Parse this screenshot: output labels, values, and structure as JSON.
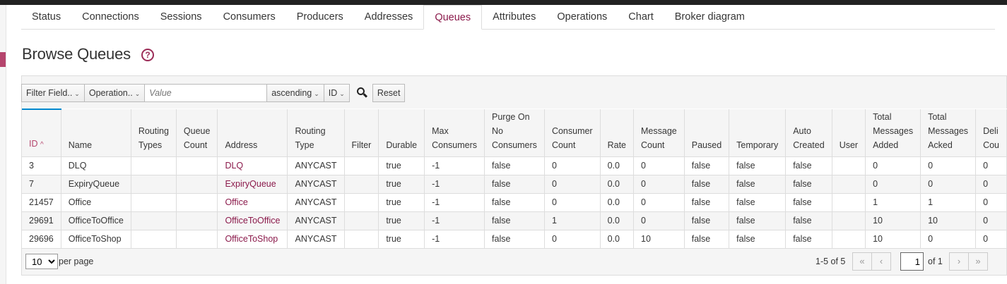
{
  "tabs": [
    {
      "label": "Status"
    },
    {
      "label": "Connections"
    },
    {
      "label": "Sessions"
    },
    {
      "label": "Consumers"
    },
    {
      "label": "Producers"
    },
    {
      "label": "Addresses"
    },
    {
      "label": "Queues",
      "active": true
    },
    {
      "label": "Attributes"
    },
    {
      "label": "Operations"
    },
    {
      "label": "Chart"
    },
    {
      "label": "Broker diagram"
    }
  ],
  "page": {
    "title": "Browse Queues",
    "help_icon": "question-circle-icon",
    "accent_color": "#8b1a4b"
  },
  "filter": {
    "field_label": "Filter Field..",
    "operation_label": "Operation..",
    "value_placeholder": "Value",
    "order_label": "ascending",
    "sort_field_label": "ID",
    "reset_label": "Reset"
  },
  "table": {
    "columns": [
      "ID",
      "Name",
      "Routing\nTypes",
      "Queue\nCount",
      "Address",
      "Routing\nType",
      "Filter",
      "Durable",
      "Max\nConsumers",
      "Purge On\nNo\nConsumers",
      "Consumer\nCount",
      "Rate",
      "Message\nCount",
      "Paused",
      "Temporary",
      "Auto\nCreated",
      "User",
      "Total\nMessages\nAdded",
      "Total\nMessages\nAcked",
      "Deli\nCou"
    ],
    "sort_indicator": "^",
    "rows": [
      [
        "3",
        "DLQ",
        "",
        "",
        "DLQ",
        "ANYCAST",
        "",
        "true",
        "-1",
        "false",
        "0",
        "0.0",
        "0",
        "false",
        "false",
        "false",
        "",
        "0",
        "0",
        "0"
      ],
      [
        "7",
        "ExpiryQueue",
        "",
        "",
        "ExpiryQueue",
        "ANYCAST",
        "",
        "true",
        "-1",
        "false",
        "0",
        "0.0",
        "0",
        "false",
        "false",
        "false",
        "",
        "0",
        "0",
        "0"
      ],
      [
        "21457",
        "Office",
        "",
        "",
        "Office",
        "ANYCAST",
        "",
        "true",
        "-1",
        "false",
        "0",
        "0.0",
        "0",
        "false",
        "false",
        "false",
        "",
        "1",
        "1",
        "0"
      ],
      [
        "29691",
        "OfficeToOffice",
        "",
        "",
        "OfficeToOffice",
        "ANYCAST",
        "",
        "true",
        "-1",
        "false",
        "1",
        "0.0",
        "0",
        "false",
        "false",
        "false",
        "",
        "10",
        "10",
        "0"
      ],
      [
        "29696",
        "OfficeToShop",
        "",
        "",
        "OfficeToShop",
        "ANYCAST",
        "",
        "true",
        "-1",
        "false",
        "0",
        "0.0",
        "10",
        "false",
        "false",
        "false",
        "",
        "10",
        "0",
        "0"
      ]
    ]
  },
  "pagination": {
    "per_page_value": "10",
    "per_page_label": "per page",
    "range": "1-5 of 5",
    "first": "«",
    "prev": "‹",
    "current_page": "1",
    "of_pages": "of 1",
    "next": "›",
    "last": "»"
  }
}
